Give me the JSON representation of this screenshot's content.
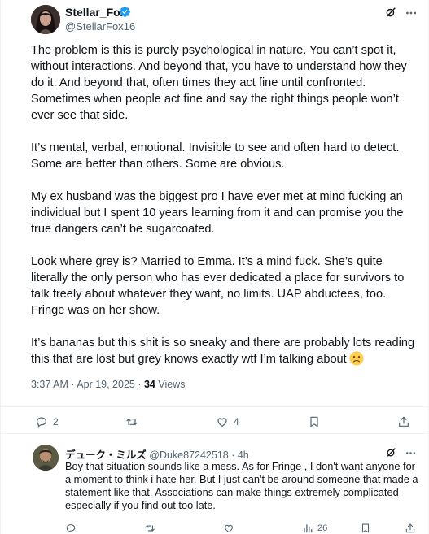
{
  "post": {
    "author_name": "Stellar_Fox",
    "author_handle": "@StellarFox16",
    "paragraphs": [
      "The problem is this is purely psychological in nature. You can’t spot it, without interactions. And beyond that, you have to understand how they do it. And beyond that, often times they act fine until confronted. Sometimes when people act fine and say the right things people won’t ever see that side.",
      "It’s mental, verbal, emotional. Invisible to see and often hard to detect. Some are better than others. Some are obvious.",
      "My ex husband was the biggest pro I have ever met at mind fucking an individual but I spent 10 years learning from it and can promise you the true dangers can’t be sugarcoated.",
      "Look where grey is? Married to Emma. It’s a mind fuck. She’s quite literally the only person who has ever dedicated a place for survivors to talk freely about whatever they want, no limits. UAP abductees, too. Fringe was on her show.",
      "It’s bananas but this shit is so sneaky and there are probably lots reading this that are lost but grey knows exactly wtf I’m talking about"
    ],
    "emoji": "confused-face",
    "timestamp": "3:37 AM · Apr 19, 2025 · ",
    "views_count": "34",
    "views_label": " Views",
    "replies_count": "2",
    "reposts_count": "",
    "likes_count": "4"
  },
  "reply": {
    "author_name": "デューク・ミルズ",
    "author_handle": "@Duke87242518",
    "separator": " · ",
    "time": "4h",
    "text": "Boy that situation sounds like a mess. As for Fringe , I don't want anyone for a moment to think i hate her. But I just can't be around someone that made a statement like that. Associations can make things extremely complicated especially if you find out too late.",
    "views_count": "26"
  },
  "colors": {
    "text": "#0f1419",
    "secondary": "#536471",
    "verified": "#1d9bf0",
    "divider": "#eff3f4"
  }
}
